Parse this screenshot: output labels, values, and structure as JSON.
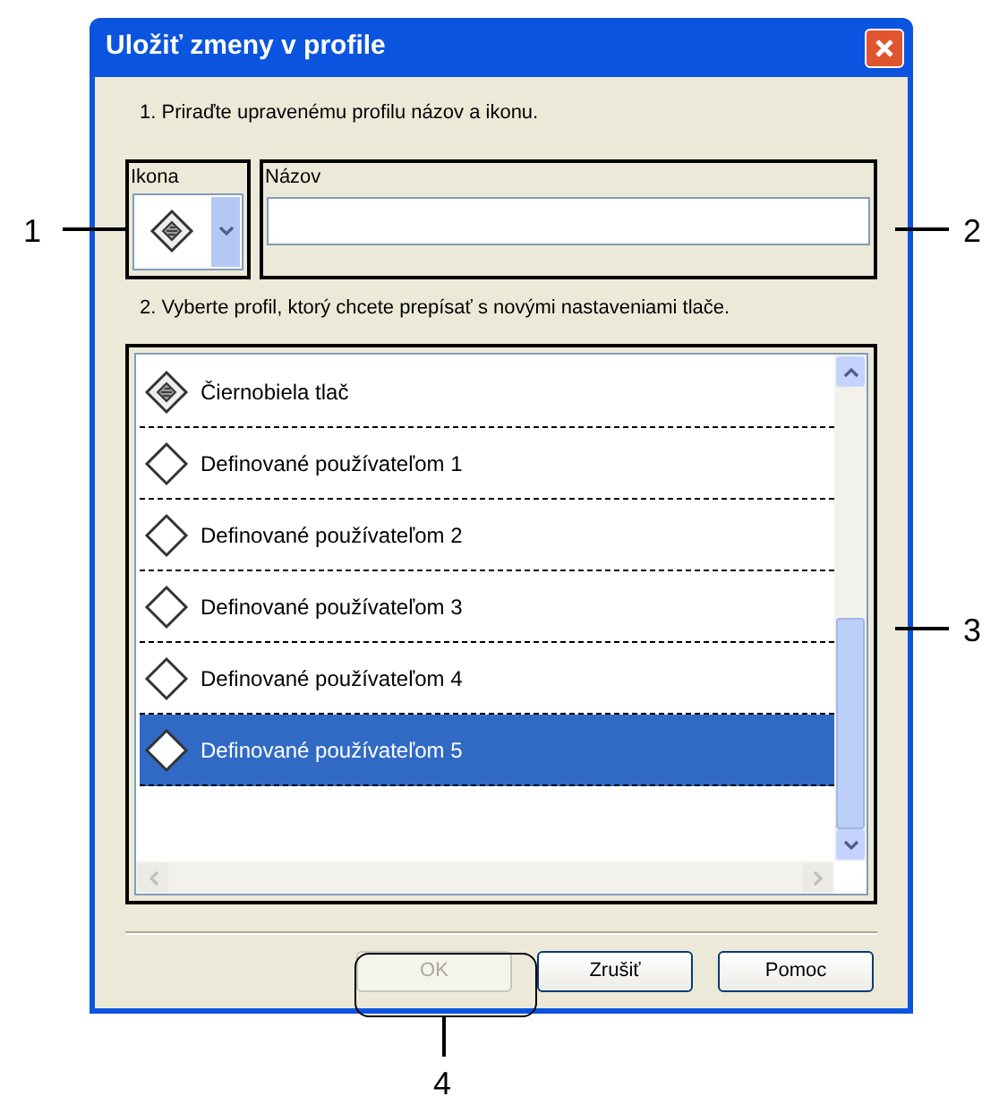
{
  "window": {
    "title": "Uložiť zmeny v profile"
  },
  "step_1": "1. Priraďte upravenému profilu názov a ikonu.",
  "icon_field": {
    "label": "Ikona"
  },
  "name_field": {
    "label": "Názov"
  },
  "step_2": "2. Vyberte profil, ktorý chcete prepísať s novými nastaveniami tlače.",
  "profiles": [
    {
      "label": "Čiernobiela tlač",
      "kind": "document",
      "selected": false
    },
    {
      "label": "Definované používateľom 1",
      "kind": "diamond",
      "selected": false
    },
    {
      "label": "Definované používateľom 2",
      "kind": "diamond",
      "selected": false
    },
    {
      "label": "Definované používateľom 3",
      "kind": "diamond",
      "selected": false
    },
    {
      "label": "Definované používateľom 4",
      "kind": "diamond",
      "selected": false
    },
    {
      "label": "Definované používateľom 5",
      "kind": "diamond",
      "selected": true
    }
  ],
  "buttons": [
    {
      "label": "OK",
      "disabled": true
    },
    {
      "label": "Zrušiť",
      "disabled": false
    },
    {
      "label": "Pomoc",
      "disabled": false
    }
  ],
  "callouts": [
    "1",
    "2",
    "3",
    "4"
  ]
}
